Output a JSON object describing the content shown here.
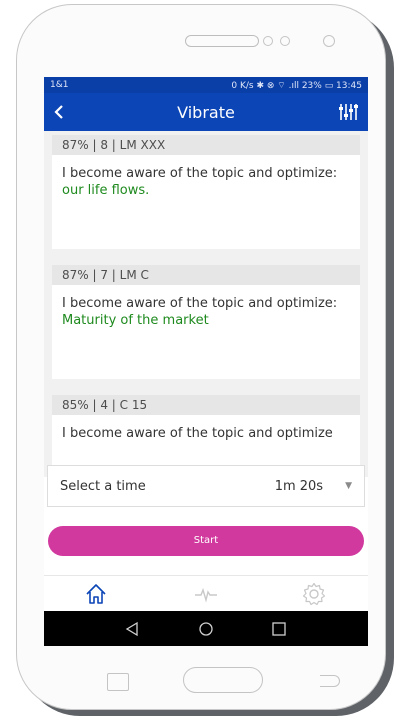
{
  "status_bar": {
    "carrier": "1&1",
    "right": "0 K/s ✱ ⊗ ⌔ .ıll 23% ▭ 13:45"
  },
  "app_bar": {
    "title": "Vibrate"
  },
  "cards": [
    {
      "header": "87% | 8 | LM XXX",
      "text": "I become aware of the topic and optimize:",
      "highlight": "our life flows."
    },
    {
      "header": "87% | 7 | LM C",
      "text": "I become aware of the topic and optimize:",
      "highlight": "Maturity of the market"
    },
    {
      "header": "85% | 4 | C 15",
      "text": "I become aware of the topic and optimize",
      "highlight": ""
    }
  ],
  "time_select": {
    "label": "Select a time",
    "value": "1m 20s"
  },
  "start_button": {
    "label": "Start"
  },
  "bottom_nav": {
    "items": [
      "home-icon",
      "pulse-icon",
      "settings-icon"
    ],
    "active_color": "#0c45b6",
    "inactive_color": "#c8c8c8"
  },
  "colors": {
    "app_bar": "#0c45b6",
    "accent": "#d2399e",
    "highlight_text": "#1e8a1e"
  }
}
